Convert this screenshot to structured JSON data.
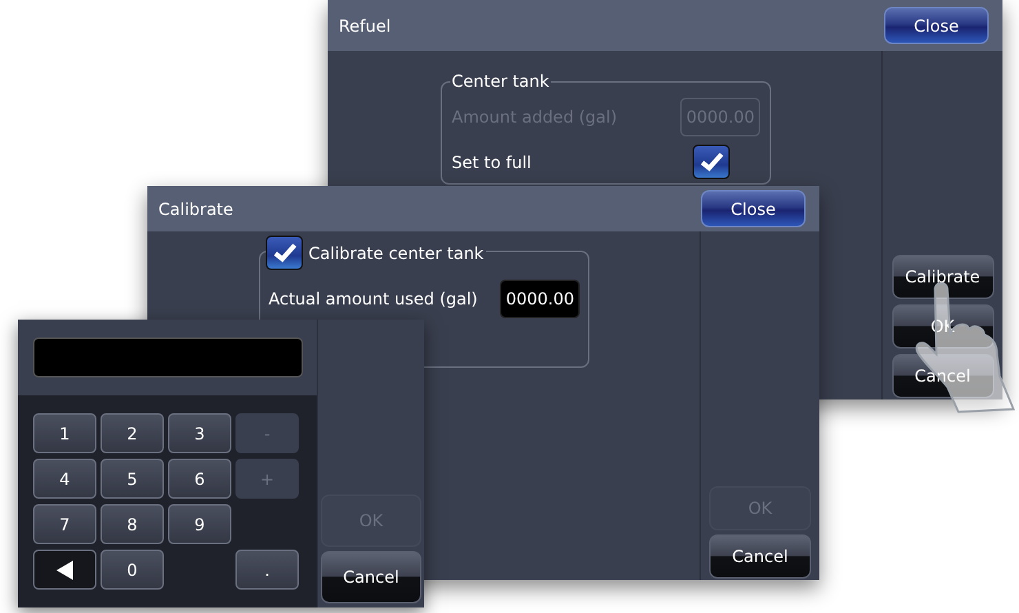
{
  "refuel": {
    "title": "Refuel",
    "close_button": "Close",
    "group_title": "Center tank",
    "fields": [
      {
        "kind": "input",
        "label": "Amount added (gal)",
        "value": "0000.00",
        "disabled": true
      },
      {
        "kind": "checkbox",
        "label": "Set to full",
        "checked": true
      }
    ],
    "buttons": [
      {
        "label": "Calibrate",
        "disabled": false
      },
      {
        "label": "OK",
        "disabled": false
      },
      {
        "label": "Cancel",
        "disabled": false
      }
    ]
  },
  "calibrate": {
    "title": "Calibrate",
    "close_button": "Close",
    "group_checkbox": {
      "label": "Calibrate center tank",
      "checked": true
    },
    "fields": [
      {
        "kind": "input",
        "label": "Actual amount used (gal)",
        "value": "0000.00",
        "disabled": false
      }
    ],
    "buttons": [
      {
        "label": "OK",
        "disabled": true
      },
      {
        "label": "Cancel",
        "disabled": false
      }
    ]
  },
  "keypad": {
    "rows": [
      [
        {
          "kind": "key",
          "label": "1",
          "disabled": false
        },
        {
          "kind": "key",
          "label": "2",
          "disabled": false
        },
        {
          "kind": "key",
          "label": "3",
          "disabled": false
        },
        {
          "kind": "key",
          "label": "-",
          "disabled": true
        }
      ],
      [
        {
          "kind": "key",
          "label": "4",
          "disabled": false
        },
        {
          "kind": "key",
          "label": "5",
          "disabled": false
        },
        {
          "kind": "key",
          "label": "6",
          "disabled": false
        },
        {
          "kind": "key",
          "label": "+",
          "disabled": true
        }
      ],
      [
        {
          "kind": "key",
          "label": "7",
          "disabled": false
        },
        {
          "kind": "key",
          "label": "8",
          "disabled": false
        },
        {
          "kind": "key",
          "label": "9",
          "disabled": false
        },
        {
          "kind": "blank"
        }
      ],
      [
        {
          "kind": "backspace",
          "disabled": false
        },
        {
          "kind": "key",
          "label": "0",
          "disabled": false
        },
        {
          "kind": "blank"
        },
        {
          "kind": "key",
          "label": ".",
          "disabled": false
        }
      ]
    ],
    "buttons": [
      {
        "label": "OK",
        "disabled": true
      },
      {
        "label": "Cancel",
        "disabled": false
      }
    ]
  }
}
